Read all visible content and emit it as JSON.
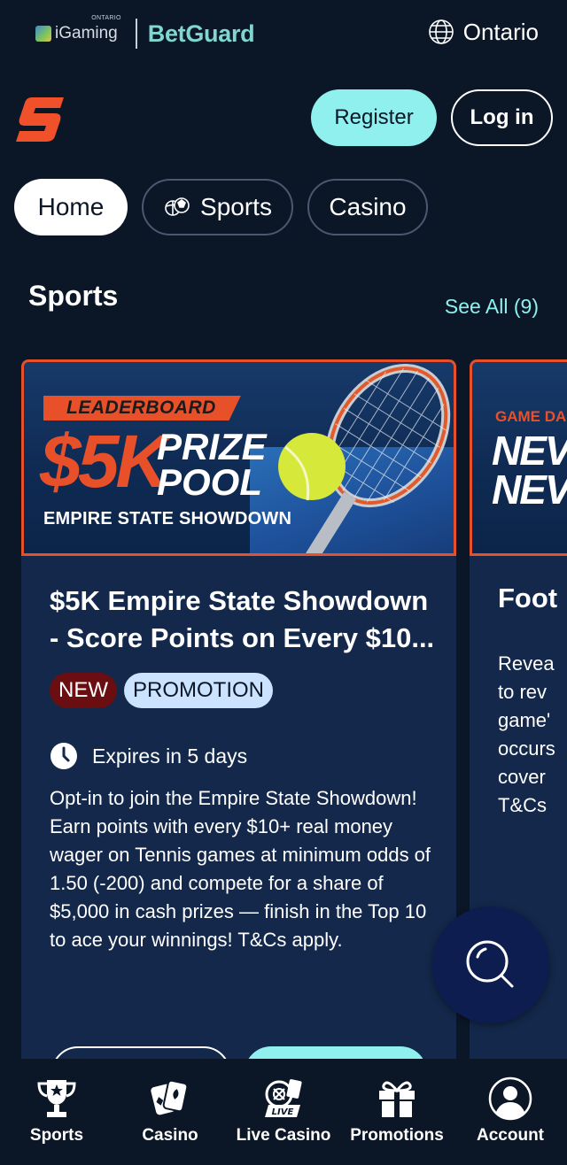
{
  "topbar": {
    "igaming_label": "iGaming",
    "igaming_superscript": "ONTARIO",
    "partner_label": "BetGuard",
    "region_label": "Ontario",
    "region_icon": "globe-icon"
  },
  "header": {
    "logo_icon": "brand-s-logo",
    "register_label": "Register",
    "login_label": "Log in"
  },
  "tabs": [
    {
      "label": "Home",
      "active": true
    },
    {
      "label": "Sports",
      "icon": "sports-balls-icon"
    },
    {
      "label": "Casino"
    }
  ],
  "section": {
    "title": "Sports",
    "see_all": "See All (9)"
  },
  "cards": [
    {
      "banner": {
        "tag": "LEADERBOARD",
        "amount": "$5K",
        "prize_line1": "PRIZE",
        "prize_line2": "POOL",
        "subtitle": "EMPIRE STATE SHOWDOWN"
      },
      "title": "$5K Empire State Showdown - Score Points on Every $10...",
      "badges": [
        "NEW",
        "PROMOTION"
      ],
      "expiry": "Expires in 5 days",
      "description": "Opt-in to join the Empire State Showdown! Earn points with every $10+ real money wager on Tennis games at minimum odds of 1.50 (-200) and compete for a share of $5,000 in cash prizes — finish in the Top 10 to ace your winnings! T&Cs apply."
    },
    {
      "banner": {
        "tag": "GAME DA",
        "line1": "NEV",
        "line2": "NEV"
      },
      "title": "Foot",
      "description": "Revea\nto rev\ngame'\noccurs\ncover\nT&Cs"
    }
  ],
  "fab": {
    "icon": "search-icon"
  },
  "bottom_nav": [
    {
      "label": "Sports",
      "icon": "trophy-icon"
    },
    {
      "label": "Casino",
      "icon": "cards-icon"
    },
    {
      "label": "Live Casino",
      "icon": "live-roulette-icon",
      "badge": "LIVE"
    },
    {
      "label": "Promotions",
      "icon": "gift-icon"
    },
    {
      "label": "Account",
      "icon": "account-icon"
    }
  ],
  "colors": {
    "background": "#0b1627",
    "card": "#13284a",
    "accent": "#8ff0ee",
    "brand_orange": "#e8502a"
  }
}
